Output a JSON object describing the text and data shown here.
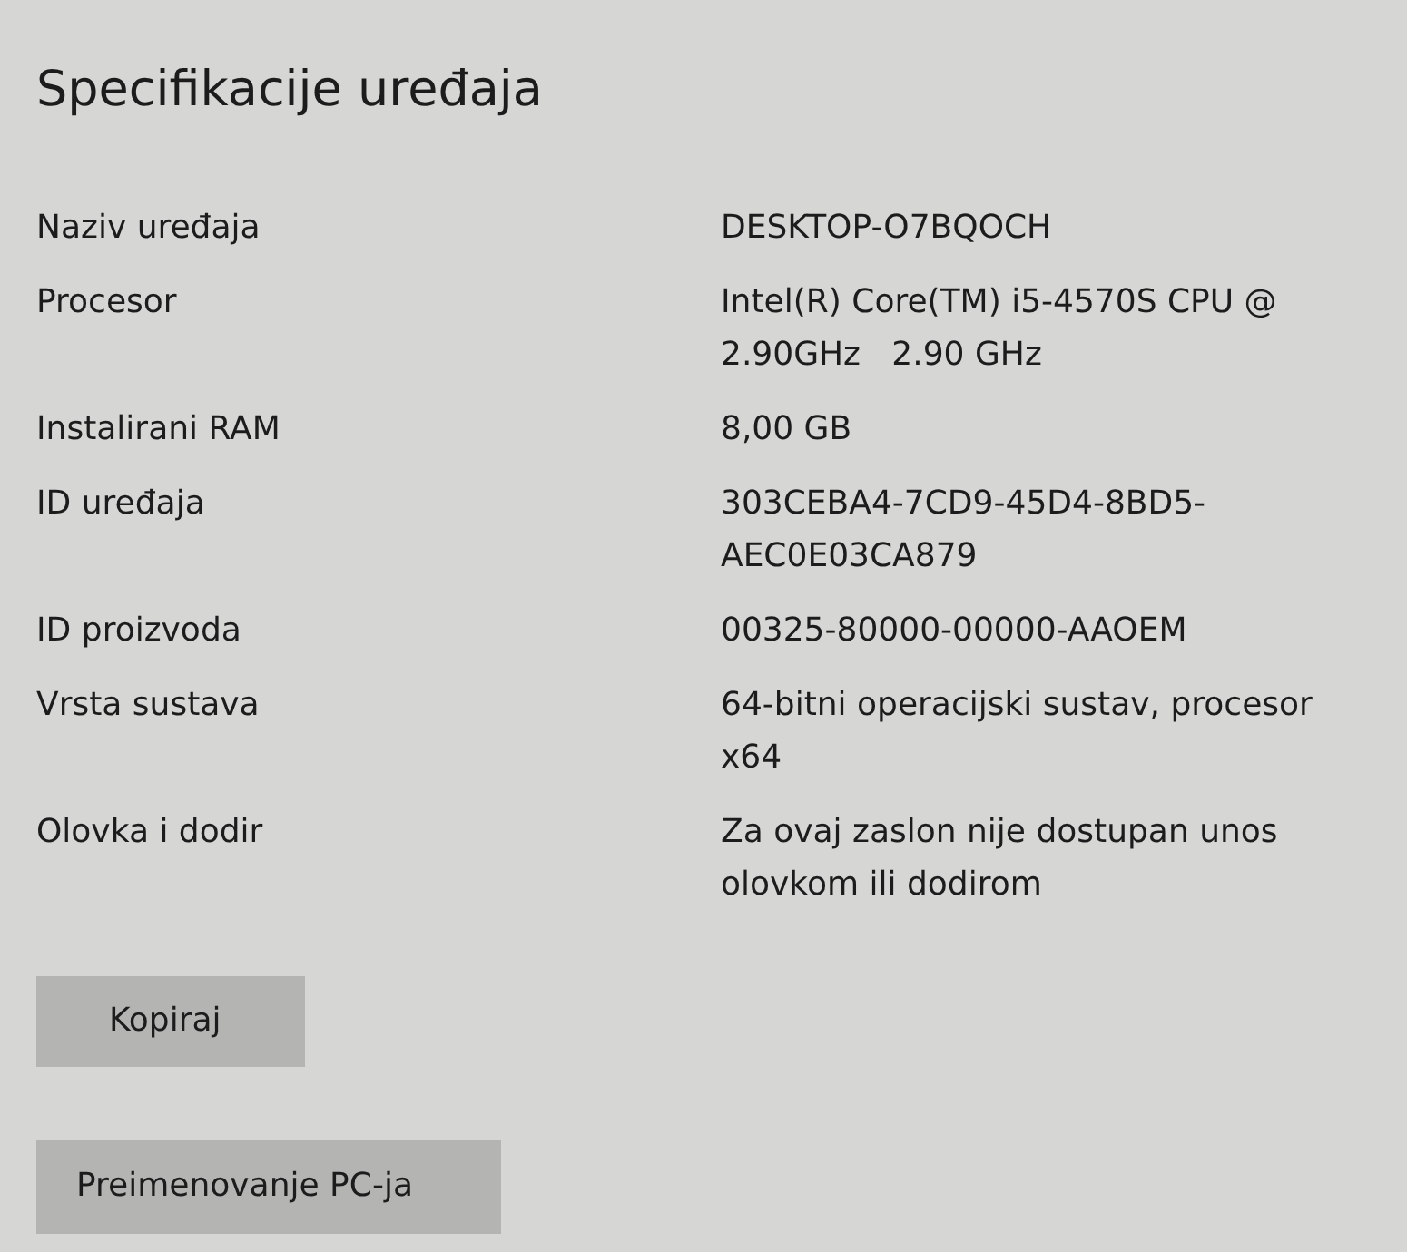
{
  "title": "Specifikacije uređaja",
  "specs": [
    {
      "label": "Naziv uređaja",
      "value": "DESKTOP-O7BQOCH"
    },
    {
      "label": "Procesor",
      "value": "Intel(R) Core(TM) i5-4570S CPU @ 2.90GHz   2.90 GHz"
    },
    {
      "label": "Instalirani RAM",
      "value": "8,00 GB"
    },
    {
      "label": "ID uređaja",
      "value": "303CEBA4-7CD9-45D4-8BD5-AEC0E03CA879"
    },
    {
      "label": "ID proizvoda",
      "value": "00325-80000-00000-AAOEM"
    },
    {
      "label": "Vrsta sustava",
      "value": "64-bitni operacijski sustav, procesor x64"
    },
    {
      "label": "Olovka i dodir",
      "value": "Za ovaj zaslon nije dostupan unos olovkom ili dodirom"
    }
  ],
  "buttons": [
    "Kopiraj",
    "Preimenovanje PC-ja"
  ]
}
